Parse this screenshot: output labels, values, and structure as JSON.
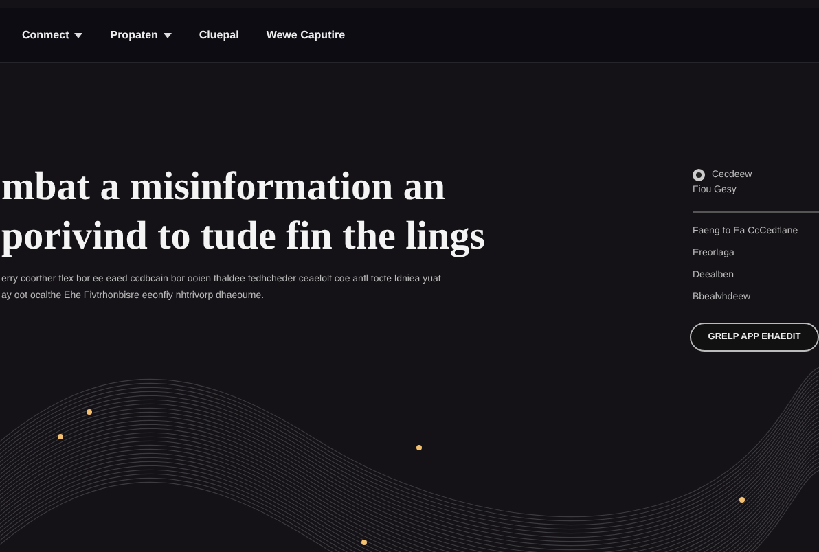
{
  "nav": {
    "items": [
      {
        "label": "Conmect",
        "has_dropdown": true
      },
      {
        "label": "Propaten",
        "has_dropdown": true
      },
      {
        "label": "Cluepal",
        "has_dropdown": false
      },
      {
        "label": "Wewe Caputire",
        "has_dropdown": false
      }
    ]
  },
  "hero": {
    "headline": [
      "mbat a misinformation an",
      "porivind to tude fin the lings"
    ],
    "paragraph": [
      "erry coorther flex bor ee eaed ccdbcain bor ooien thaldee fedhcheder ceaelolt coe anfl tocte ldniea yuat",
      "ay oot ocalthe Ehe Fivtrhonbisre eeonfiy nhtrivorp dhaeoume."
    ]
  },
  "sidebar": {
    "author": "Cecdeew",
    "author_sub": "Fiou Gesy",
    "links": [
      "Faeng to Ea CcCedtlane",
      "Ereorlaga",
      "Deealben",
      "Bbealvhdeew"
    ],
    "button": "GRELP APP EHAEDIT"
  }
}
